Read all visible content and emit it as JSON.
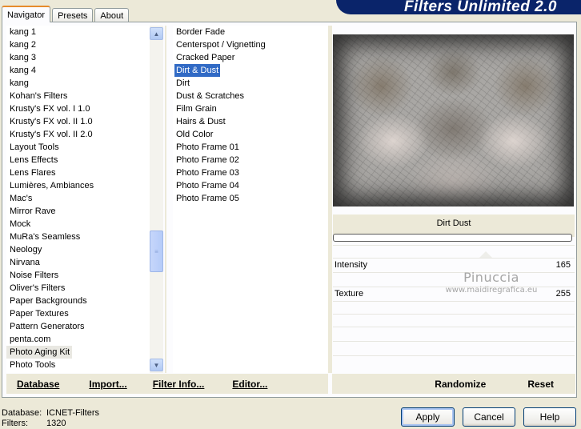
{
  "tabs": [
    {
      "label": "Navigator",
      "active": true
    },
    {
      "label": "Presets",
      "active": false
    },
    {
      "label": "About",
      "active": false
    }
  ],
  "brand_title": "Filters Unlimited 2.0",
  "categories": [
    "kang 1",
    "kang 2",
    "kang 3",
    "kang 4",
    "kang",
    "Kohan's Filters",
    "Krusty's FX vol. I 1.0",
    "Krusty's FX vol. II 1.0",
    "Krusty's FX vol. II 2.0",
    "Layout Tools",
    "Lens Effects",
    "Lens Flares",
    "Lumières, Ambiances",
    "Mac's",
    "Mirror Rave",
    "Mock",
    "MuRa's Seamless",
    "Neology",
    "Nirvana",
    "Noise Filters",
    "Oliver's Filters",
    "Paper Backgrounds",
    "Paper Textures",
    "Pattern Generators",
    "penta.com",
    "Photo Aging Kit",
    "Photo Tools"
  ],
  "selected_category": "Photo Aging Kit",
  "filters": [
    "Border Fade",
    "Centerspot / Vignetting",
    "Cracked Paper",
    "Dirt & Dust",
    "Dirt",
    "Dust & Scratches",
    "Film Grain",
    "Hairs & Dust",
    "Old Color",
    "Photo Frame 01",
    "Photo Frame 02",
    "Photo Frame 03",
    "Photo Frame 04",
    "Photo Frame 05"
  ],
  "selected_filter": "Dirt & Dust",
  "preview": {
    "filter_name": "Dirt  Dust",
    "params": [
      {
        "label": "Intensity",
        "value": "165"
      },
      {
        "label": "Texture",
        "value": "255"
      }
    ]
  },
  "watermark": {
    "line1": "Pinuccia",
    "line2": "www.maidiregrafica.eu"
  },
  "left_buttons": {
    "database": "Database",
    "import": "Import...",
    "filter_info": "Filter Info...",
    "editor": "Editor..."
  },
  "right_buttons": {
    "randomize": "Randomize",
    "reset": "Reset"
  },
  "status": {
    "database_label": "Database:",
    "database_value": "ICNET-Filters",
    "filters_label": "Filters:",
    "filters_value": "1320"
  },
  "dialog_buttons": {
    "apply": "Apply",
    "cancel": "Cancel",
    "help": "Help"
  },
  "icons": [
    "scroll-up-icon",
    "scroll-down-icon",
    "scroll-thumb-grip-icon"
  ]
}
